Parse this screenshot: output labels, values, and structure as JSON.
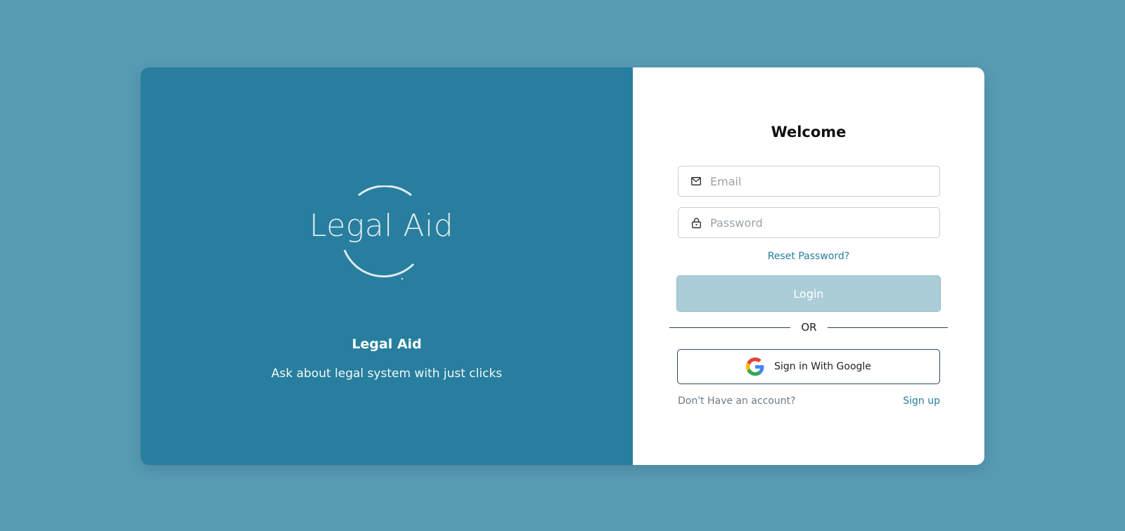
{
  "colors": {
    "page_background": "#579ab3",
    "brand_panel": "#277e9e",
    "accent": "#277e9e",
    "login_button_disabled": "#abcdd8"
  },
  "brand": {
    "logo_text": "Legal Aid",
    "title": "Legal Aid",
    "tagline": "Ask about legal system with just clicks"
  },
  "login_form": {
    "heading": "Welcome",
    "email": {
      "placeholder": "Email",
      "value": "",
      "icon": "mail-icon"
    },
    "password": {
      "placeholder": "Password",
      "value": "",
      "icon": "lock-icon"
    },
    "reset_password_label": "Reset Password?",
    "login_label": "Login",
    "divider_label": "OR",
    "google_label": "Sign in With Google",
    "google_icon": "google-icon",
    "no_account_text": "Don't Have an account?",
    "signup_label": "Sign up"
  }
}
